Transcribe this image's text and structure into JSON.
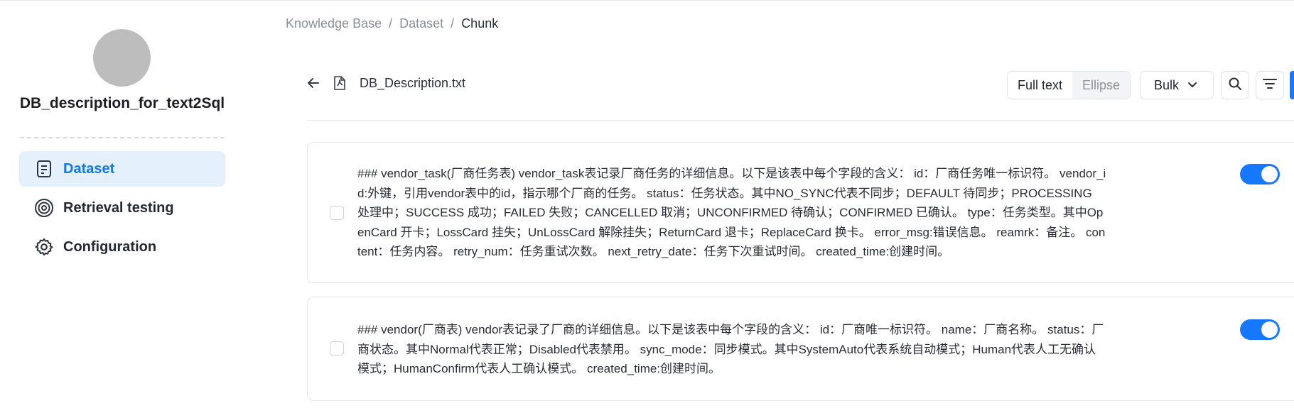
{
  "sidebar": {
    "kb_name": "DB_description_for_text2Sql",
    "items": [
      {
        "label": "Dataset",
        "icon": "document-icon",
        "active": true
      },
      {
        "label": "Retrieval testing",
        "icon": "target-icon",
        "active": false
      },
      {
        "label": "Configuration",
        "icon": "gear-icon",
        "active": false
      }
    ]
  },
  "breadcrumb": {
    "items": [
      "Knowledge Base",
      "Dataset",
      "Chunk"
    ],
    "separator": "/"
  },
  "toolbar": {
    "file_name": "DB_Description.txt",
    "view_modes": [
      "Full text",
      "Ellipse"
    ],
    "selected_view": "Full text",
    "bulk_label": "Bulk"
  },
  "chunks": [
    {
      "text": "### vendor_task(厂商任务表) vendor_task表记录厂商任务的详细信息。以下是该表中每个字段的含义： id：厂商任务唯一标识符。 vendor_id:外键，引用vendor表中的id，指示哪个厂商的任务。 status：任务状态。其中NO_SYNC代表不同步；DEFAULT 待同步；PROCESSING 处理中；SUCCESS 成功；FAILED 失败；CANCELLED 取消；UNCONFIRMED 待确认；CONFIRMED 已确认。 type：任务类型。其中OpenCard 开卡；LossCard 挂失；UnLossCard 解除挂失；ReturnCard 退卡；ReplaceCard 换卡。 error_msg:错误信息。 reamrk：备注。 content：任务内容。 retry_num：任务重试次数。 next_retry_date：任务下次重试时间。 created_time:创建时间。",
      "enabled": true,
      "checked": false
    },
    {
      "text": "### vendor(厂商表) vendor表记录了厂商的详细信息。以下是该表中每个字段的含义： id：厂商唯一标识符。 name：厂商名称。 status：厂商状态。其中Normal代表正常；Disabled代表禁用。 sync_mode：同步模式。其中SystemAuto代表系统自动模式；Human代表人工无确认模式；HumanConfirm代表人工确认模式。 created_time:创建时间。",
      "enabled": true,
      "checked": false
    }
  ],
  "colors": {
    "accent": "#1677ff",
    "active_nav_bg": "#e4f0fc",
    "avatar": "#bdbdbd"
  }
}
